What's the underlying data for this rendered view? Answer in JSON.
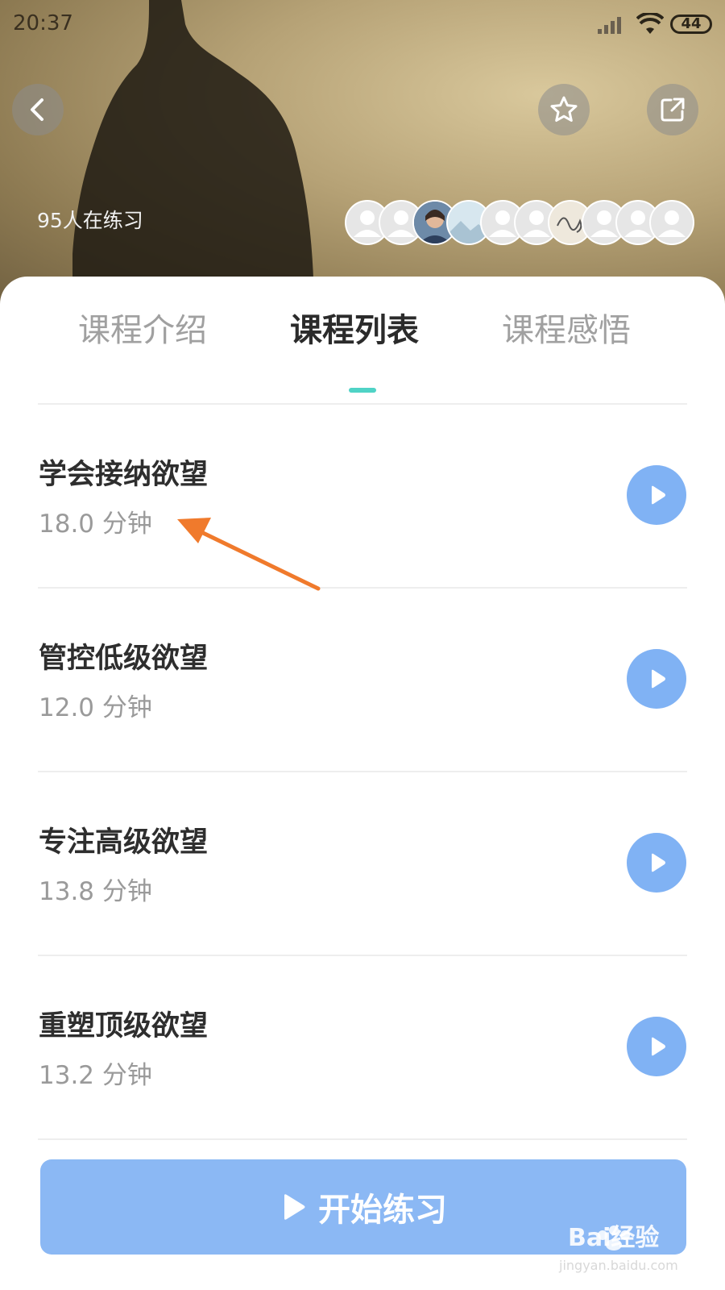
{
  "status_bar": {
    "time": "20:37",
    "battery": "44"
  },
  "hero": {
    "practice_count": "95人在练习",
    "avatars": [
      "user",
      "user",
      "photo",
      "image",
      "user",
      "user",
      "signature",
      "user",
      "user",
      "user"
    ]
  },
  "header_icons": {
    "back": "chevron-left-icon",
    "favorite": "star-icon",
    "share": "share-icon"
  },
  "tabs": [
    {
      "label": "课程介绍",
      "active": false
    },
    {
      "label": "课程列表",
      "active": true
    },
    {
      "label": "课程感悟",
      "active": false
    }
  ],
  "lessons": [
    {
      "title": "学会接纳欲望",
      "duration": "18.0 分钟"
    },
    {
      "title": "管控低级欲望",
      "duration": "12.0 分钟"
    },
    {
      "title": "专注高级欲望",
      "duration": "13.8 分钟"
    },
    {
      "title": "重塑顶级欲望",
      "duration": "13.2 分钟"
    }
  ],
  "start_button": {
    "label": "开始练习"
  },
  "watermark": {
    "text": "Bai经验",
    "sub": "jingyan.baidu.com"
  },
  "colors": {
    "accent": "#4fd3c6",
    "play": "#80b2f4",
    "start": "#8bb8f4",
    "annotation_arrow": "#f07a2c"
  }
}
